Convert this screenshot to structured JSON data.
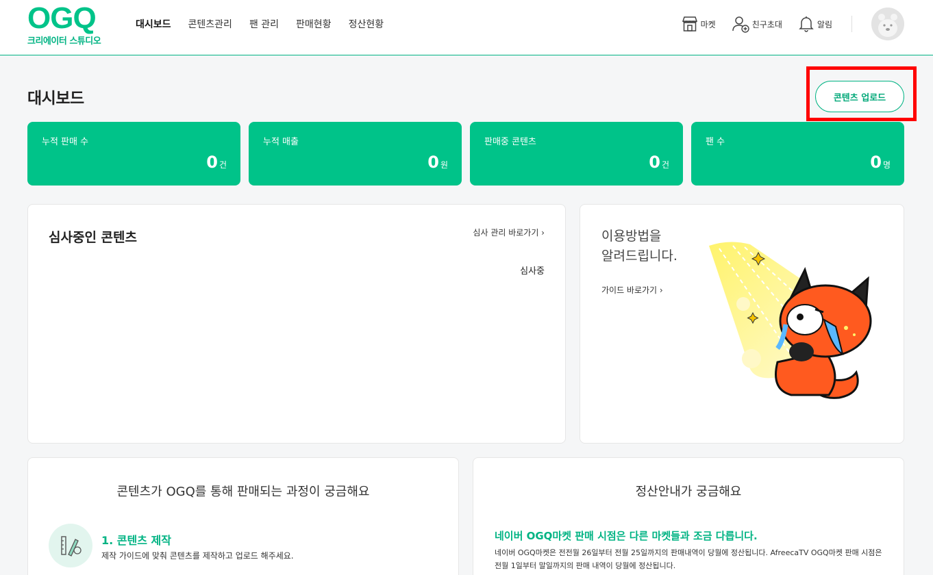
{
  "header": {
    "logo_text": "OGQ",
    "logo_sub": "크리에이터 스튜디오",
    "nav": [
      {
        "label": "대시보드",
        "active": true
      },
      {
        "label": "콘텐츠관리",
        "active": false
      },
      {
        "label": "팬 관리",
        "active": false
      },
      {
        "label": "판매현황",
        "active": false
      },
      {
        "label": "정산현황",
        "active": false
      }
    ],
    "market_label": "마켓",
    "invite_label": "친구초대",
    "alert_label": "알림"
  },
  "page": {
    "title": "대시보드",
    "upload_button": "콘텐츠 업로드"
  },
  "stats": [
    {
      "label": "누적 판매 수",
      "value": "0",
      "unit": "건"
    },
    {
      "label": "누적 매출",
      "value": "0",
      "unit": "원"
    },
    {
      "label": "판매중 콘텐츠",
      "value": "0",
      "unit": "건"
    },
    {
      "label": "팬 수",
      "value": "0",
      "unit": "명"
    }
  ],
  "review": {
    "title": "심사중인 콘텐츠",
    "link": "심사 관리 바로가기 ›",
    "status": "심사중"
  },
  "guide": {
    "title_line1": "이용방법을",
    "title_line2": "알려드립니다.",
    "link": "가이드 바로가기 ›"
  },
  "process": {
    "title": "콘텐츠가 OGQ를 통해 판매되는 과정이 궁금해요",
    "step_title": "1. 콘텐츠 제작",
    "step_desc": "제작 가이드에 맞춰 콘텐츠를 제작하고 업로드 해주세요."
  },
  "settle": {
    "title": "정산안내가 궁금해요",
    "headline": "네이버 OGQ마켓 판매 시점은 다른 마켓들과 조금 다릅니다.",
    "body": "네이버 OGQ마켓은 전전월 26일부터 전월 25일까지의 판매내역이 당월에 정산됩니다. AfreecaTV OGQ마켓 판매 시점은 전월 1일부터 말일까지의 판매 내역이 당월에 정산됩니다."
  },
  "colors": {
    "brand": "#00c389",
    "highlight": "#ff0000"
  }
}
